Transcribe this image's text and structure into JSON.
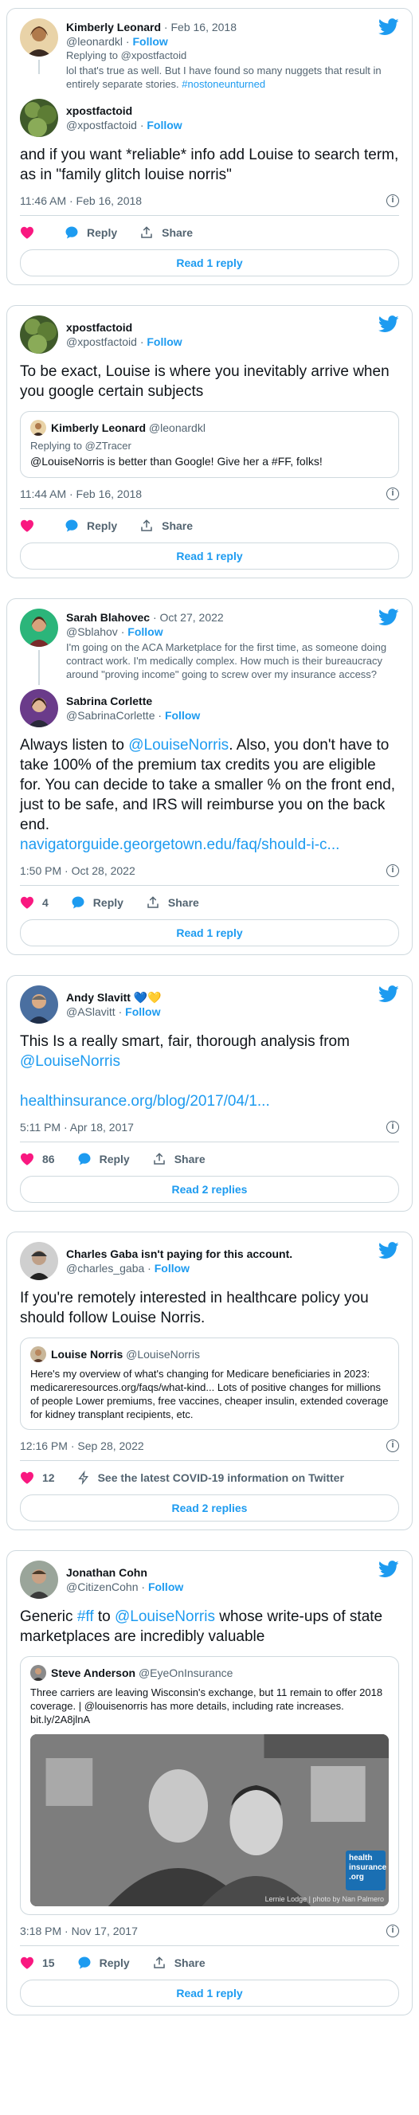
{
  "tweets": [
    {
      "parent": {
        "name": "Kimberly Leonard",
        "date": "Feb 16, 2018",
        "handle": "@leonardkl",
        "follow": "Follow",
        "replying": "Replying to @xpostfactoid",
        "text": "lol that's true as well. But I have found so many nuggets that result in entirely separate stories.",
        "hashtag": "#nostoneunturned"
      },
      "author": {
        "name": "xpostfactoid",
        "handle": "@xpostfactoid",
        "follow": "Follow"
      },
      "text": "and if you want *reliable* info add Louise to search term, as in \"family glitch louise norris\"",
      "time": "11:46 AM · Feb 16, 2018",
      "likes": "",
      "reply_label": "Reply",
      "share_label": "Share",
      "read_label": "Read 1 reply"
    },
    {
      "author": {
        "name": "xpostfactoid",
        "handle": "@xpostfactoid",
        "follow": "Follow"
      },
      "text": "To be exact, Louise is where you inevitably arrive when you google certain subjects",
      "quote": {
        "name": "Kimberly Leonard",
        "handle": "@leonardkl",
        "replying": "Replying to @ZTracer",
        "text": "@LouiseNorris is better than Google! Give her a #FF, folks!"
      },
      "time": "11:44 AM · Feb 16, 2018",
      "reply_label": "Reply",
      "share_label": "Share",
      "read_label": "Read 1 reply"
    },
    {
      "parent": {
        "name": "Sarah Blahovec",
        "date": "Oct 27, 2022",
        "handle": "@Sblahov",
        "follow": "Follow",
        "text": "I'm going on the ACA Marketplace for the first time, as someone doing contract work. I'm medically complex. How much is their bureaucracy around \"proving income\" going to screw over my insurance access?"
      },
      "author": {
        "name": "Sabrina Corlette",
        "handle": "@SabrinaCorlette",
        "follow": "Follow"
      },
      "text_pre": "Always listen to ",
      "mention": "@LouiseNorris",
      "text_post": ". Also, you don't have to take 100% of the premium tax credits you are eligible for. You can decide to take a smaller % on the front end, just to be safe, and IRS will reimburse you on the back end.",
      "link": "navigatorguide.georgetown.edu/faq/should-i-c...",
      "time": "1:50 PM · Oct 28, 2022",
      "likes": "4",
      "reply_label": "Reply",
      "share_label": "Share",
      "read_label": "Read 1 reply"
    },
    {
      "author": {
        "name": "Andy Slavitt",
        "emoji": "💙💛",
        "handle": "@ASlavitt",
        "follow": "Follow"
      },
      "text": "This Is a really smart, fair, thorough analysis from",
      "mention": "@LouiseNorris",
      "link": "healthinsurance.org/blog/2017/04/1...",
      "time": "5:11 PM · Apr 18, 2017",
      "likes": "86",
      "reply_label": "Reply",
      "share_label": "Share",
      "read_label": "Read 2 replies"
    },
    {
      "author": {
        "name": "Charles Gaba isn't paying for this account.",
        "handle": "@charles_gaba",
        "follow": "Follow"
      },
      "text": "If you're remotely interested in healthcare policy you should follow Louise Norris.",
      "quote": {
        "name": "Louise Norris",
        "handle": "@LouiseNorris",
        "text": "Here's my overview of what's changing for Medicare beneficiaries in 2023: medicareresources.org/faqs/what-kind... Lots of positive changes for millions of people Lower premiums, free vaccines, cheaper insulin, extended coverage for kidney transplant recipients, etc."
      },
      "time": "12:16 PM · Sep 28, 2022",
      "likes": "12",
      "covid_label": "See the latest COVID-19 information on Twitter",
      "read_label": "Read 2 replies"
    },
    {
      "author": {
        "name": "Jonathan Cohn",
        "handle": "@CitizenCohn",
        "follow": "Follow"
      },
      "text_pre": "Generic ",
      "hashtag": "#ff",
      "text_mid": " to ",
      "mention": "@LouiseNorris",
      "text_post": " whose write-ups of state marketplaces are incredibly valuable",
      "quote": {
        "name": "Steve Anderson",
        "handle": "@EyeOnInsurance",
        "text": "Three carriers are leaving Wisconsin's exchange, but 11 remain to offer 2018 coverage. | @louisenorris has more details, including rate increases. bit.ly/2A8jlnA",
        "photo_logo": "health insurance .org",
        "photo_credit": "Lernie Lodge | photo by Nan Palmero"
      },
      "time": "3:18 PM · Nov 17, 2017",
      "likes": "15",
      "reply_label": "Reply",
      "share_label": "Share",
      "read_label": "Read 1 reply"
    }
  ],
  "colors": {
    "accent": "#1d9bf0",
    "like": "#f91880",
    "text": "#0f1419",
    "muted": "#536471",
    "border": "#cfd9de"
  }
}
